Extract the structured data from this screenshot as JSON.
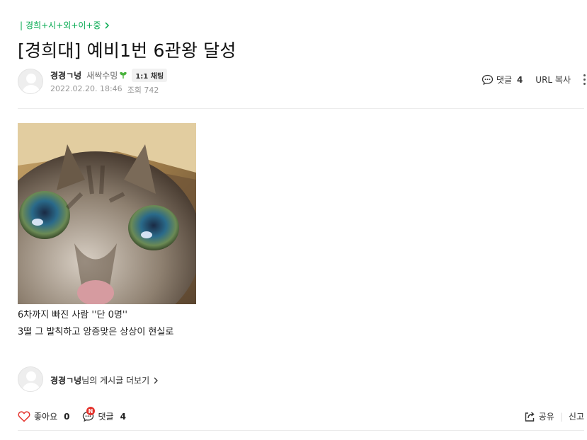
{
  "board": {
    "label": "경희+시+외+이+중"
  },
  "post": {
    "title": "[경희대] 예비1번 6관왕 달성",
    "author": "경경ㄱ넝",
    "level": "새싹수밍",
    "chat_label": "1:1 채팅",
    "date": "2022.02.20. 18:46",
    "views_label": "조회 742",
    "comment_label": "댓글",
    "comment_count": "4",
    "url_copy": "URL 복사",
    "body_lines": [
      "6차까지 빠진 사람 ''단 0명''",
      "3떨 그 발칙하고 앙증맞은 상상이 현실로"
    ],
    "more_posts_name": "경경ㄱ넝",
    "more_posts_suffix": "님의 게시글 더보기"
  },
  "footer": {
    "like_label": "좋아요",
    "like_count": "0",
    "comment_label": "댓글",
    "comment_count": "4",
    "new_badge": "N",
    "share_label": "공유",
    "report_label": "신고"
  },
  "colors": {
    "accent": "#03a94f",
    "like": "#e4332d"
  }
}
